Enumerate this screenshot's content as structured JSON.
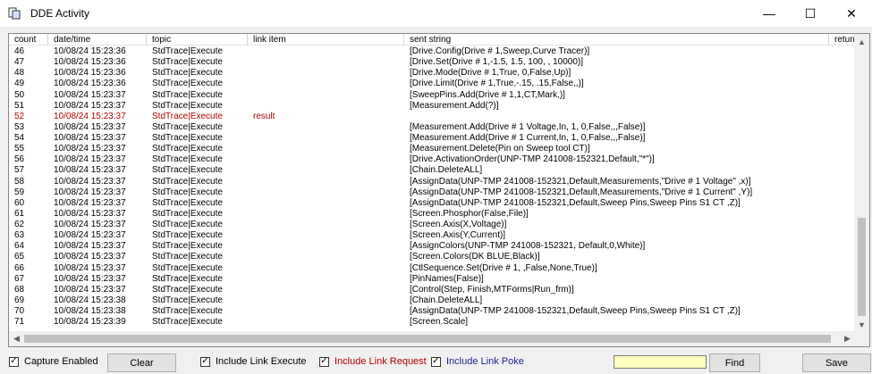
{
  "window": {
    "title": "DDE Activity",
    "minimize": "—",
    "maximize": "☐",
    "close": "✕"
  },
  "columns": [
    "count",
    "date/time",
    "topic",
    "link item",
    "sent string",
    "return"
  ],
  "rows": [
    {
      "count": "46",
      "datetime": "10/08/24 15:23:36",
      "topic": "StdTrace|Execute",
      "link": "",
      "sent": "[Drive.Config(Drive # 1,Sweep,Curve Tracer)]",
      "ret": "",
      "red": false
    },
    {
      "count": "47",
      "datetime": "10/08/24 15:23:36",
      "topic": "StdTrace|Execute",
      "link": "",
      "sent": "[Drive.Set(Drive # 1,-1.5, 1.5, 100, , 10000)]",
      "ret": "",
      "red": false
    },
    {
      "count": "48",
      "datetime": "10/08/24 15:23:36",
      "topic": "StdTrace|Execute",
      "link": "",
      "sent": "[Drive.Mode(Drive # 1,True, 0,False,Up)]",
      "ret": "",
      "red": false
    },
    {
      "count": "49",
      "datetime": "10/08/24 15:23:36",
      "topic": "StdTrace|Execute",
      "link": "",
      "sent": "[Drive.Limit(Drive # 1,True,-.15, .15,False,,)]",
      "ret": "",
      "red": false
    },
    {
      "count": "50",
      "datetime": "10/08/24 15:23:37",
      "topic": "StdTrace|Execute",
      "link": "",
      "sent": "[SweepPins.Add(Drive # 1,1,CT,Mark,)]",
      "ret": "",
      "red": false
    },
    {
      "count": "51",
      "datetime": "10/08/24 15:23:37",
      "topic": "StdTrace|Execute",
      "link": "",
      "sent": "[Measurement.Add(?)]",
      "ret": "",
      "red": false
    },
    {
      "count": "52",
      "datetime": "10/08/24 15:23:37",
      "topic": "StdTrace|Execute",
      "link": "result",
      "sent": "",
      "ret": "",
      "red": true
    },
    {
      "count": "53",
      "datetime": "10/08/24 15:23:37",
      "topic": "StdTrace|Execute",
      "link": "",
      "sent": "[Measurement.Add(Drive # 1 Voltage,In, 1, 0,False,,,False)]",
      "ret": "",
      "red": false
    },
    {
      "count": "54",
      "datetime": "10/08/24 15:23:37",
      "topic": "StdTrace|Execute",
      "link": "",
      "sent": "[Measurement.Add(Drive # 1 Current,In, 1, 0,False,,,False)]",
      "ret": "",
      "red": false
    },
    {
      "count": "55",
      "datetime": "10/08/24 15:23:37",
      "topic": "StdTrace|Execute",
      "link": "",
      "sent": "[Measurement.Delete(Pin on Sweep tool CT)]",
      "ret": "",
      "red": false
    },
    {
      "count": "56",
      "datetime": "10/08/24 15:23:37",
      "topic": "StdTrace|Execute",
      "link": "",
      "sent": "[Drive.ActivationOrder(UNP-TMP 241008-152321,Default,\"*\")]",
      "ret": "",
      "red": false
    },
    {
      "count": "57",
      "datetime": "10/08/24 15:23:37",
      "topic": "StdTrace|Execute",
      "link": "",
      "sent": "[Chain.DeleteALL]",
      "ret": "",
      "red": false
    },
    {
      "count": "58",
      "datetime": "10/08/24 15:23:37",
      "topic": "StdTrace|Execute",
      "link": "",
      "sent": "[AssignData(UNP-TMP 241008-152321,Default,Measurements,\"Drive # 1 Voltage\" ,x)]",
      "ret": "",
      "red": false
    },
    {
      "count": "59",
      "datetime": "10/08/24 15:23:37",
      "topic": "StdTrace|Execute",
      "link": "",
      "sent": "[AssignData(UNP-TMP 241008-152321,Default,Measurements,\"Drive # 1 Current\" ,Y)]",
      "ret": "",
      "red": false
    },
    {
      "count": "60",
      "datetime": "10/08/24 15:23:37",
      "topic": "StdTrace|Execute",
      "link": "",
      "sent": "[AssignData(UNP-TMP 241008-152321,Default,Sweep Pins,Sweep Pins S1 CT ,Z)]",
      "ret": "",
      "red": false
    },
    {
      "count": "61",
      "datetime": "10/08/24 15:23:37",
      "topic": "StdTrace|Execute",
      "link": "",
      "sent": "[Screen.Phosphor(False,File)]",
      "ret": "",
      "red": false
    },
    {
      "count": "62",
      "datetime": "10/08/24 15:23:37",
      "topic": "StdTrace|Execute",
      "link": "",
      "sent": "[Screen.Axis(X,Voltage)]",
      "ret": "",
      "red": false
    },
    {
      "count": "63",
      "datetime": "10/08/24 15:23:37",
      "topic": "StdTrace|Execute",
      "link": "",
      "sent": "[Screen.Axis(Y,Current)]",
      "ret": "",
      "red": false
    },
    {
      "count": "64",
      "datetime": "10/08/24 15:23:37",
      "topic": "StdTrace|Execute",
      "link": "",
      "sent": "[AssignColors(UNP-TMP 241008-152321, Default,0,White)]",
      "ret": "",
      "red": false
    },
    {
      "count": "65",
      "datetime": "10/08/24 15:23:37",
      "topic": "StdTrace|Execute",
      "link": "",
      "sent": "[Screen.Colors(DK BLUE,Black)]",
      "ret": "",
      "red": false
    },
    {
      "count": "66",
      "datetime": "10/08/24 15:23:37",
      "topic": "StdTrace|Execute",
      "link": "",
      "sent": "[CtlSequence.Set(Drive # 1, ,False,None,True)]",
      "ret": "",
      "red": false
    },
    {
      "count": "67",
      "datetime": "10/08/24 15:23:37",
      "topic": "StdTrace|Execute",
      "link": "",
      "sent": "[PinNames(False)]",
      "ret": "",
      "red": false
    },
    {
      "count": "68",
      "datetime": "10/08/24 15:23:37",
      "topic": "StdTrace|Execute",
      "link": "",
      "sent": "[Control(Step, Finish,MTForms|Run_frm)]",
      "ret": "",
      "red": false
    },
    {
      "count": "69",
      "datetime": "10/08/24 15:23:38",
      "topic": "StdTrace|Execute",
      "link": "",
      "sent": "[Chain.DeleteALL]",
      "ret": "",
      "red": false
    },
    {
      "count": "70",
      "datetime": "10/08/24 15:23:38",
      "topic": "StdTrace|Execute",
      "link": "",
      "sent": "[AssignData(UNP-TMP 241008-152321,Default,Sweep Pins,Sweep Pins S1 CT ,Z)]",
      "ret": "",
      "red": false
    },
    {
      "count": "71",
      "datetime": "10/08/24 15:23:39",
      "topic": "StdTrace|Execute",
      "link": "",
      "sent": "[Screen.Scale]",
      "ret": "",
      "red": false
    }
  ],
  "bottom": {
    "capture_label": "Capture Enabled",
    "clear_label": "Clear",
    "execute_label": "Include Link Execute",
    "request_label": "Include Link Request",
    "poke_label": "Include Link Poke",
    "find_value": "",
    "find_label": "Find",
    "save_label": "Save",
    "request_color": "#b00000",
    "poke_color": "#1f1f8f"
  }
}
